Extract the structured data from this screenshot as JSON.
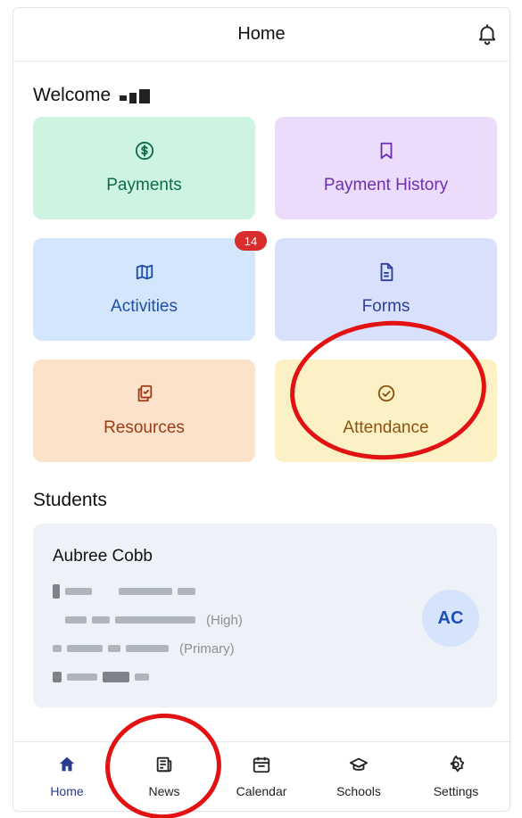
{
  "header": {
    "title": "Home",
    "bell_icon": "bell-icon"
  },
  "welcome": {
    "label": "Welcome"
  },
  "tiles": [
    {
      "label": "Payments",
      "icon": "dollar-icon",
      "color": "#0f6b48",
      "bg": "#cdf4e0"
    },
    {
      "label": "Payment History",
      "icon": "bookmark-icon",
      "color": "#6d2fb0",
      "bg": "#ecdcfb"
    },
    {
      "label": "Activities",
      "icon": "map-icon",
      "color": "#1d4ea8",
      "bg": "#d3e6fb",
      "badge": "14"
    },
    {
      "label": "Forms",
      "icon": "document-icon",
      "color": "#2c3ea0",
      "bg": "#d9e0fb"
    },
    {
      "label": "Resources",
      "icon": "clipboard-copy-icon",
      "color": "#9a3c14",
      "bg": "#fde2cb"
    },
    {
      "label": "Attendance",
      "icon": "check-circle-icon",
      "color": "#8a5212",
      "bg": "#fcf1c4"
    }
  ],
  "students": {
    "title": "Students",
    "items": [
      {
        "name": "Aubree Cobb",
        "initials": "AC",
        "school_types": [
          "(High)",
          "(Primary)"
        ]
      }
    ]
  },
  "tabbar": [
    {
      "label": "Home",
      "icon": "home-icon",
      "active": true
    },
    {
      "label": "News",
      "icon": "news-icon",
      "active": false
    },
    {
      "label": "Calendar",
      "icon": "calendar-icon",
      "active": false
    },
    {
      "label": "Schools",
      "icon": "graduation-cap-icon",
      "active": false
    },
    {
      "label": "Settings",
      "icon": "gear-icon",
      "active": false
    }
  ],
  "colors": {
    "accent": "#2a3a8e",
    "badge": "#d92d2d",
    "annotation": "#e31212"
  }
}
